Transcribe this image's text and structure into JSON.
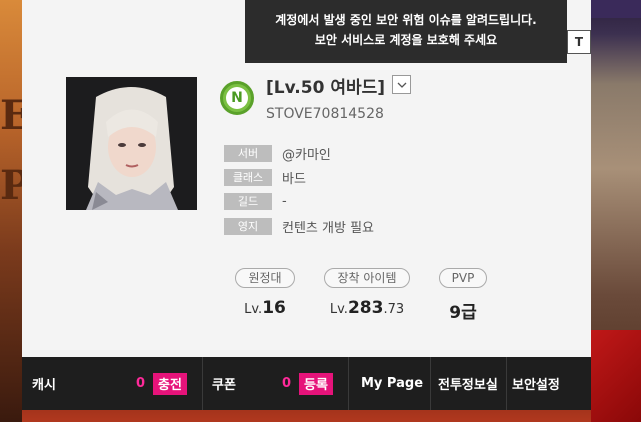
{
  "background": {
    "left_letters": [
      "E",
      "P"
    ]
  },
  "tooltip": {
    "line1": "계정에서 발생 중인 보안 위험 이슈를 알려드립니다.",
    "line2": "보안 서비스로 계정을 보호해 주세요",
    "edge_char": "T"
  },
  "character": {
    "badge_letter": "N",
    "name": "[Lv.50 여바드]",
    "account_id": "STOVE70814528"
  },
  "info": [
    {
      "tag": "서버",
      "value": "@카마인"
    },
    {
      "tag": "클래스",
      "value": "바드"
    },
    {
      "tag": "길드",
      "value": "-"
    },
    {
      "tag": "영지",
      "value": "컨텐츠 개방 필요"
    }
  ],
  "stats": {
    "expedition": {
      "label": "원정대",
      "prefix": "Lv.",
      "value": "16"
    },
    "item_level": {
      "label": "장착 아이템",
      "prefix": "Lv.",
      "value": "283",
      "decimal": ".73"
    },
    "pvp": {
      "label": "PVP",
      "value": "9급"
    }
  },
  "navbar": {
    "cash_label": "캐시",
    "cash_count": "0",
    "charge_label": "충전",
    "coupon_label": "쿠폰",
    "coupon_count": "0",
    "register_label": "등록",
    "mypage_label": "My Page",
    "battle_info_label": "전투정보실",
    "security_label": "보안설정"
  },
  "colors": {
    "accent_pink": "#e6137a",
    "count_pink": "#ff2a9a",
    "badge_green": "#7bc043",
    "nav_bg": "#1e1e1e"
  }
}
